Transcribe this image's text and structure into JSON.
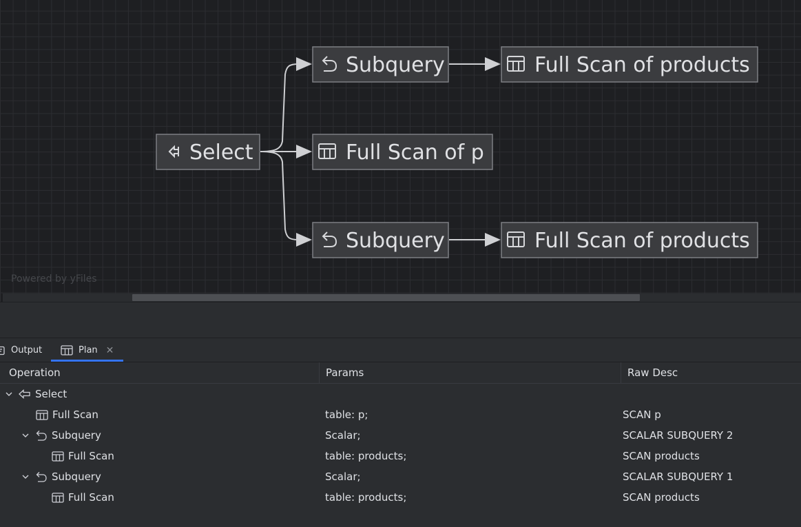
{
  "diagram": {
    "nodes": {
      "select": {
        "label": "Select",
        "icon": "select-arrow-icon"
      },
      "subquery_top": {
        "label": "Subquery",
        "icon": "subquery-return-icon"
      },
      "scan_products_top": {
        "label": "Full Scan of products",
        "icon": "table-icon"
      },
      "scan_p": {
        "label": "Full Scan of p",
        "icon": "table-icon"
      },
      "subquery_bottom": {
        "label": "Subquery",
        "icon": "subquery-return-icon"
      },
      "scan_products_bottom": {
        "label": "Full Scan of products",
        "icon": "table-icon"
      }
    },
    "watermark": "Powered by yFiles"
  },
  "tabs": {
    "output": {
      "label": "Output",
      "icon": "output-icon"
    },
    "plan": {
      "label": "Plan",
      "icon": "table-icon",
      "active": true
    }
  },
  "table": {
    "columns": {
      "operation": "Operation",
      "params": "Params",
      "raw_desc": "Raw Desc"
    },
    "rows": [
      {
        "operation": "Select",
        "params": "",
        "raw": "",
        "expanded": true,
        "icon": "select-arrow-icon"
      },
      {
        "operation": "Full Scan",
        "params": "table: p;",
        "raw": "SCAN p",
        "icon": "table-icon"
      },
      {
        "operation": "Subquery",
        "params": "Scalar;",
        "raw": "SCALAR SUBQUERY 2",
        "expanded": true,
        "icon": "subquery-return-icon"
      },
      {
        "operation": "Full Scan",
        "params": "table: products;",
        "raw": "SCAN products",
        "icon": "table-icon"
      },
      {
        "operation": "Subquery",
        "params": "Scalar;",
        "raw": "SCALAR SUBQUERY 1",
        "expanded": true,
        "icon": "subquery-return-icon"
      },
      {
        "operation": "Full Scan",
        "params": "table: products;",
        "raw": "SCAN products",
        "icon": "table-icon"
      }
    ]
  },
  "colors": {
    "accent": "#3574f0",
    "canvas_bg": "#1e1f22",
    "panel_bg": "#2b2d30"
  }
}
